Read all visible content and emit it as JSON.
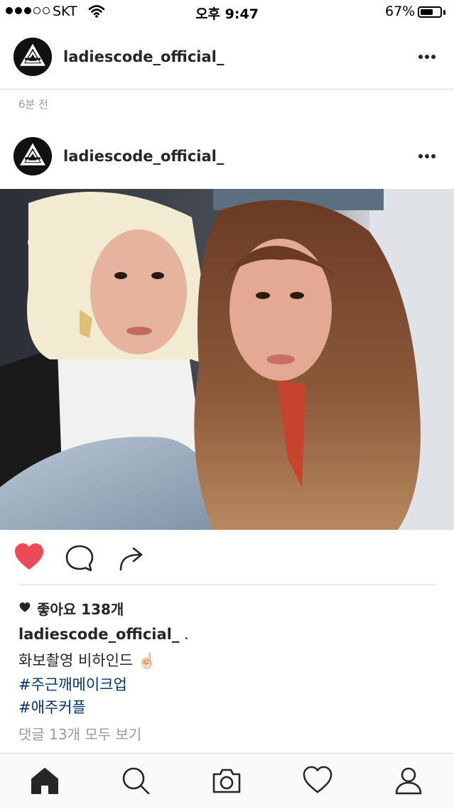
{
  "status_bar": {
    "carrier": "SKT",
    "time": "오후 9:47",
    "battery_percent_label": "67%",
    "battery_level": 0.67,
    "signal_bars_filled": 3,
    "signal_bars_total": 5
  },
  "post_header_top": {
    "username": "ladiescode_official_"
  },
  "timestamp": "6분 전",
  "post_header": {
    "username": "ladiescode_official_"
  },
  "actions": {
    "liked": true,
    "like_color": "#ed4956"
  },
  "likes": {
    "text": "좋아요 138개"
  },
  "caption": {
    "username": "ladiescode_official_",
    "after_username": " .",
    "text": "화보촬영 비하인드 ☝🏻",
    "hashtags": [
      "#주근깨메이크업",
      "#애주커플"
    ]
  },
  "comments": {
    "view_all": "댓글 13개 모두 보기"
  },
  "tab_bar": {
    "items": [
      "home-icon",
      "search-icon",
      "camera-icon",
      "heart-icon",
      "profile-icon"
    ],
    "active": "home-icon"
  },
  "colors": {
    "hashtag": "#003569",
    "secondary_text": "#999999",
    "divider": "#dbdbdb"
  }
}
